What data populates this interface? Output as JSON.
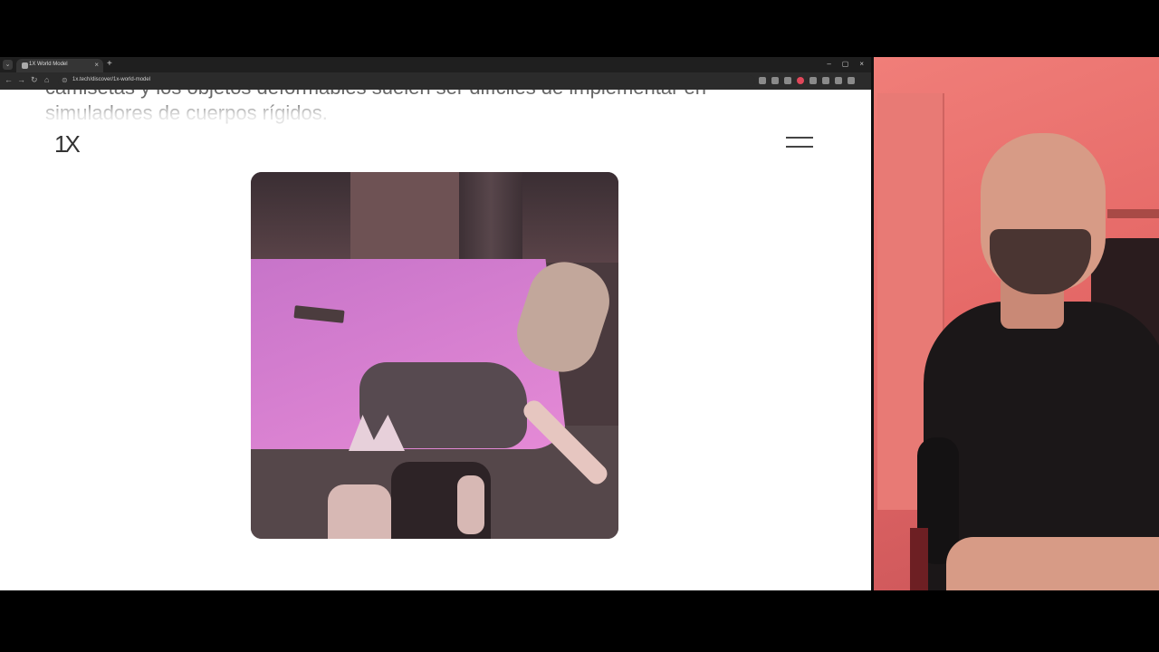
{
  "browser": {
    "tab_title": "1X World Model",
    "tab_close": "×",
    "new_tab": "+",
    "url": "1x.tech/discover/1x-world-model",
    "window_controls": [
      "–",
      "▢",
      "×"
    ]
  },
  "page": {
    "body_text": "camisetas y los objetos deformables suelen ser difíciles de implementar en simuladores de cuerpos rígidos.",
    "logo": "1X",
    "menu_icon": "hamburger-icon"
  },
  "colors": {
    "page_background": "#ffffff",
    "browser_chrome": "#1f1f1f",
    "webcam_background": "#e06a66"
  }
}
